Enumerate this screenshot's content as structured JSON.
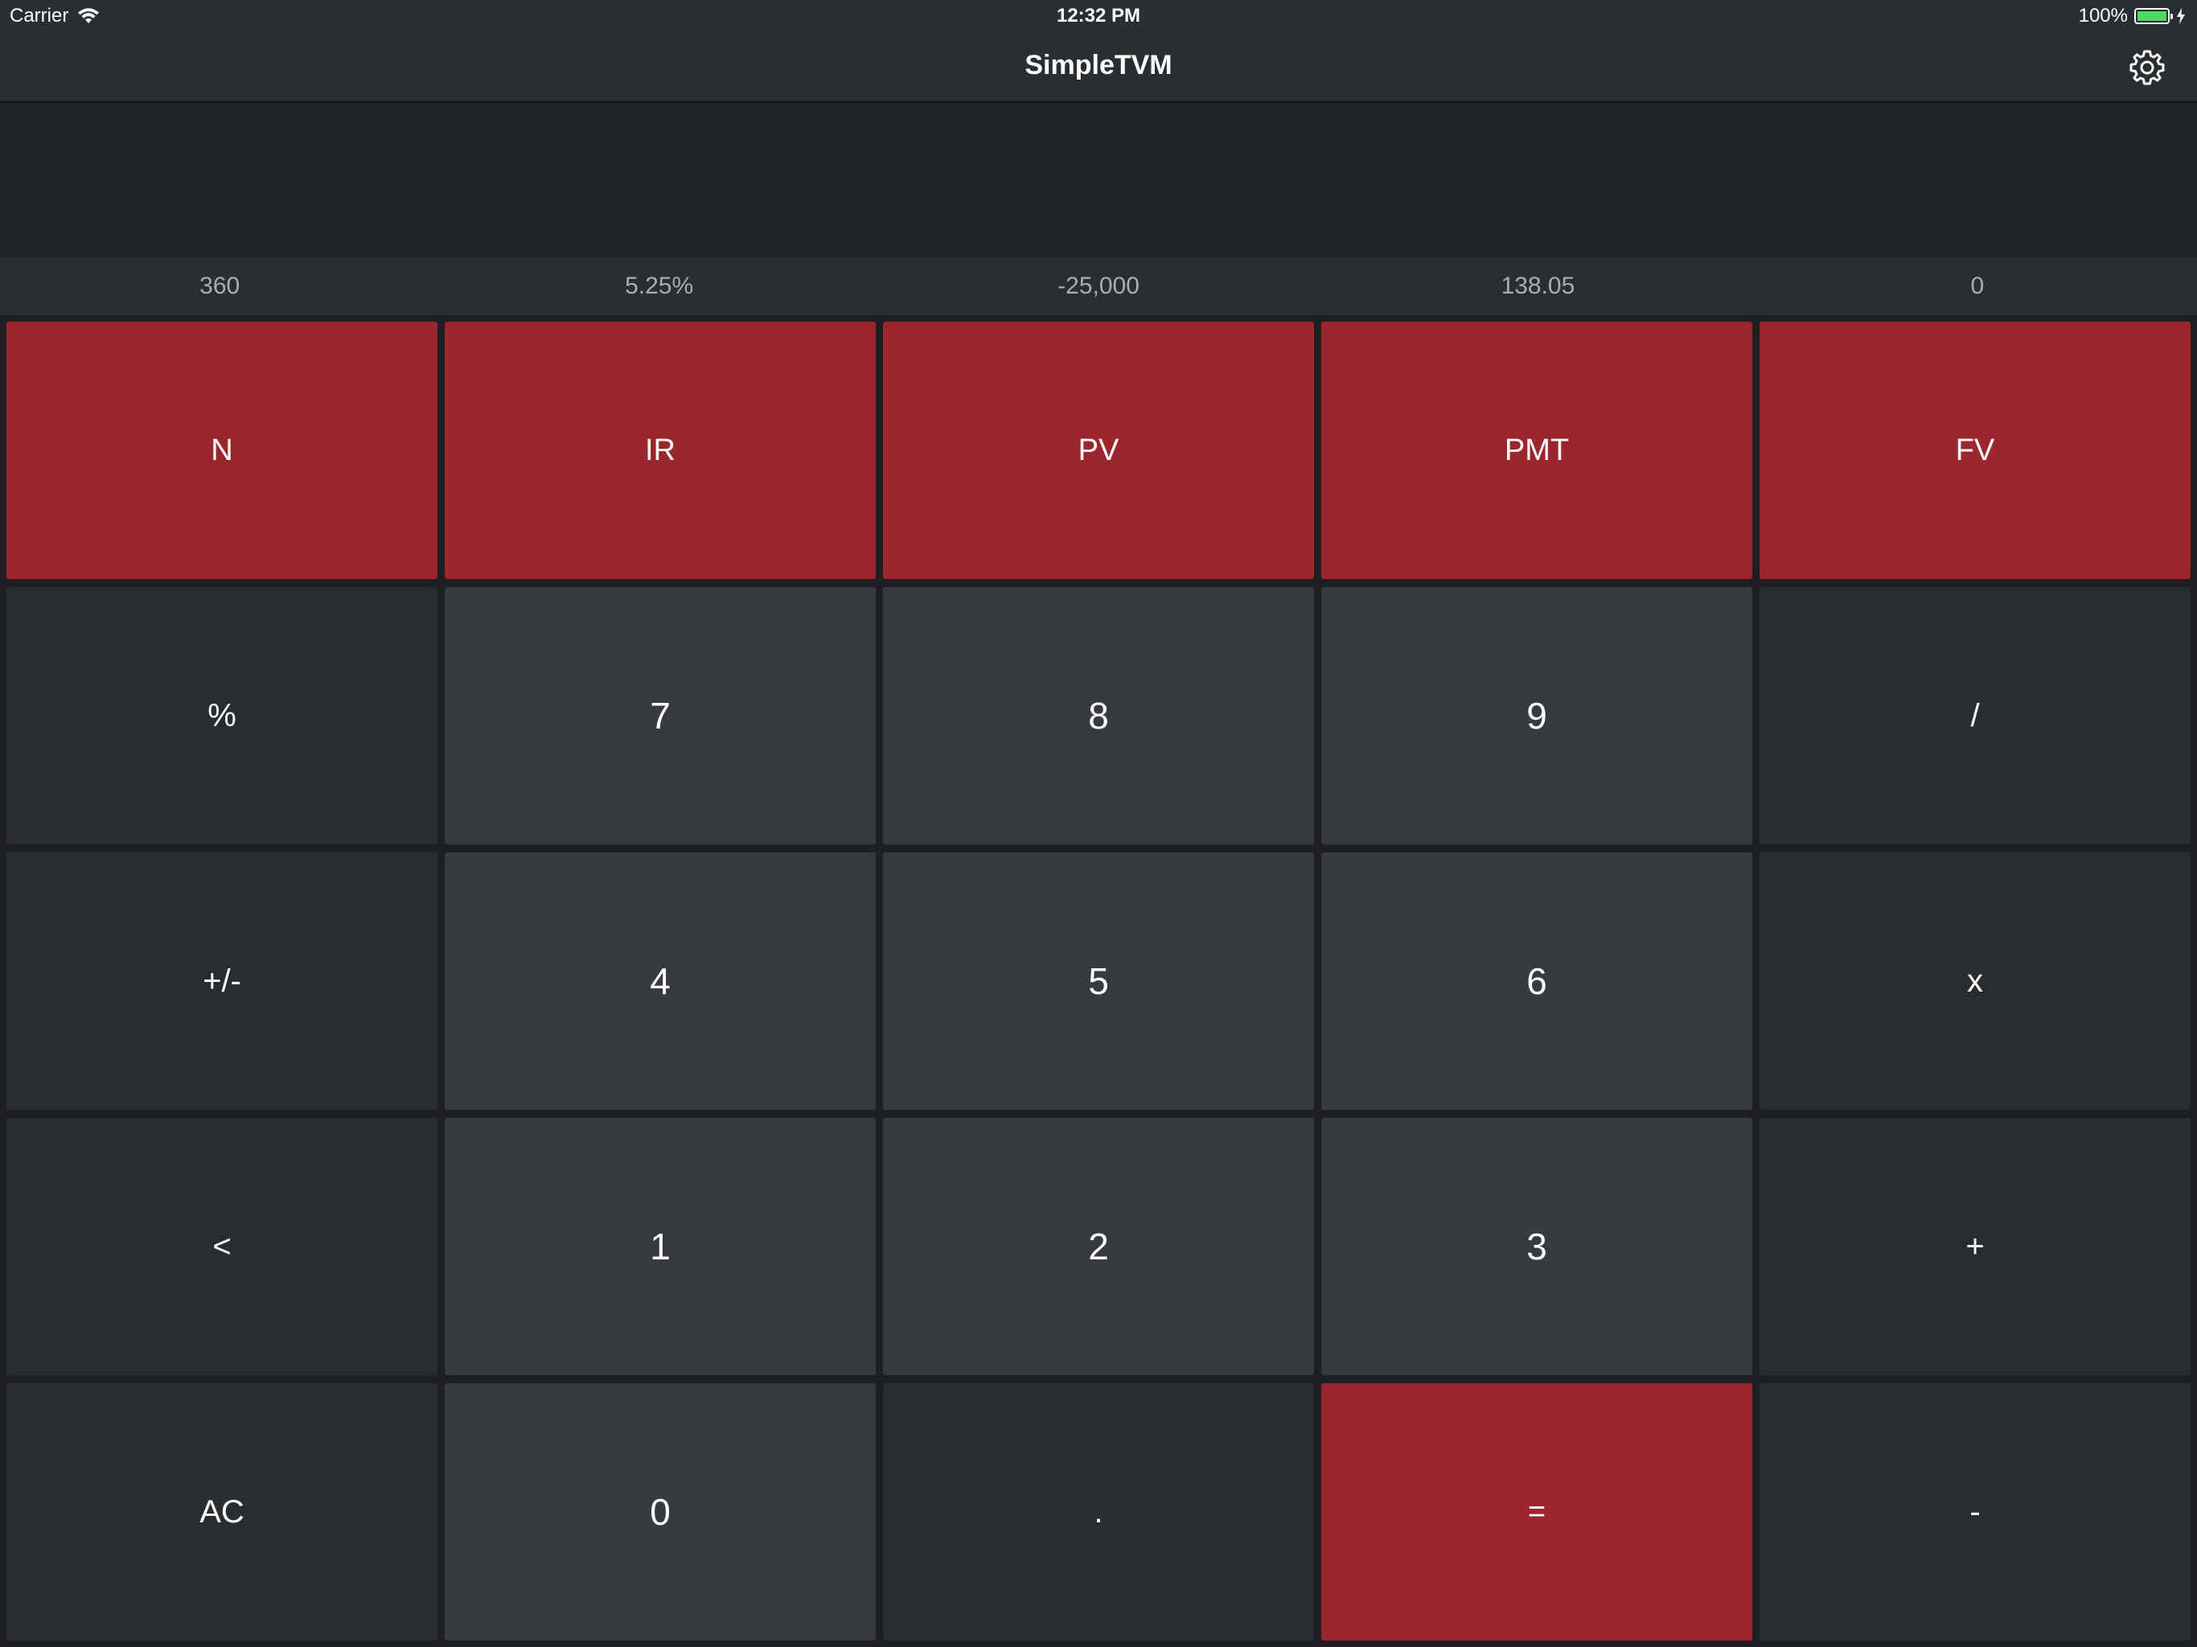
{
  "status_bar": {
    "carrier": "Carrier",
    "time": "12:32 PM",
    "battery": "100%",
    "battery_level": 1.0
  },
  "nav": {
    "title": "SimpleTVM",
    "settings_icon": "gear-icon"
  },
  "display": {
    "value": ""
  },
  "tvm_values": {
    "n": "360",
    "ir": "5.25%",
    "pv": "-25,000",
    "pmt": "138.05",
    "fv": "0"
  },
  "keys": {
    "n": "N",
    "ir": "IR",
    "pv": "PV",
    "pmt": "PMT",
    "fv": "FV",
    "percent": "%",
    "seven": "7",
    "eight": "8",
    "nine": "9",
    "divide": "/",
    "plus_minus": "+/-",
    "four": "4",
    "five": "5",
    "six": "6",
    "multiply": "x",
    "backspace": "<",
    "one": "1",
    "two": "2",
    "three": "3",
    "plus": "+",
    "clear": "AC",
    "zero": "0",
    "decimal": ".",
    "equals": "=",
    "minus": "-"
  },
  "colors": {
    "accent_red": "#9a262e",
    "number_key": "#373a3f",
    "operator_key": "#2a2d30",
    "background": "#1d1f22",
    "bar": "#2b2e31",
    "battery_green": "#4cd964"
  }
}
